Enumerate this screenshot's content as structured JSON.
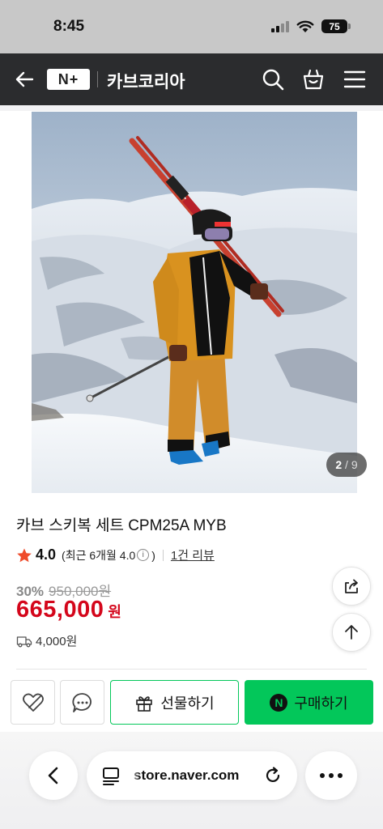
{
  "status_bar": {
    "time": "8:45",
    "battery": "75"
  },
  "header": {
    "logo": "N+",
    "store_name": "카브코리아"
  },
  "product": {
    "image_index": "2",
    "image_total": "9",
    "title": "카브 스키복 세트 CPM25A MYB",
    "rating": "4.0",
    "recent_prefix": "(최근 6개월 4.0",
    "recent_suffix": ")",
    "review_link": "1건 리뷰",
    "discount": "30%",
    "original_price": "950,000원",
    "price": "665,000",
    "price_unit": "원",
    "shipping": "4,000원"
  },
  "actions": {
    "gift_label": "선물하기",
    "buy_label": "구매하기",
    "npay_letter": "N"
  },
  "browser": {
    "url": "store.naver.com"
  },
  "colors": {
    "accent_green": "#03c75a",
    "price_red": "#d4061b",
    "header_bg": "#2b2c2e"
  }
}
